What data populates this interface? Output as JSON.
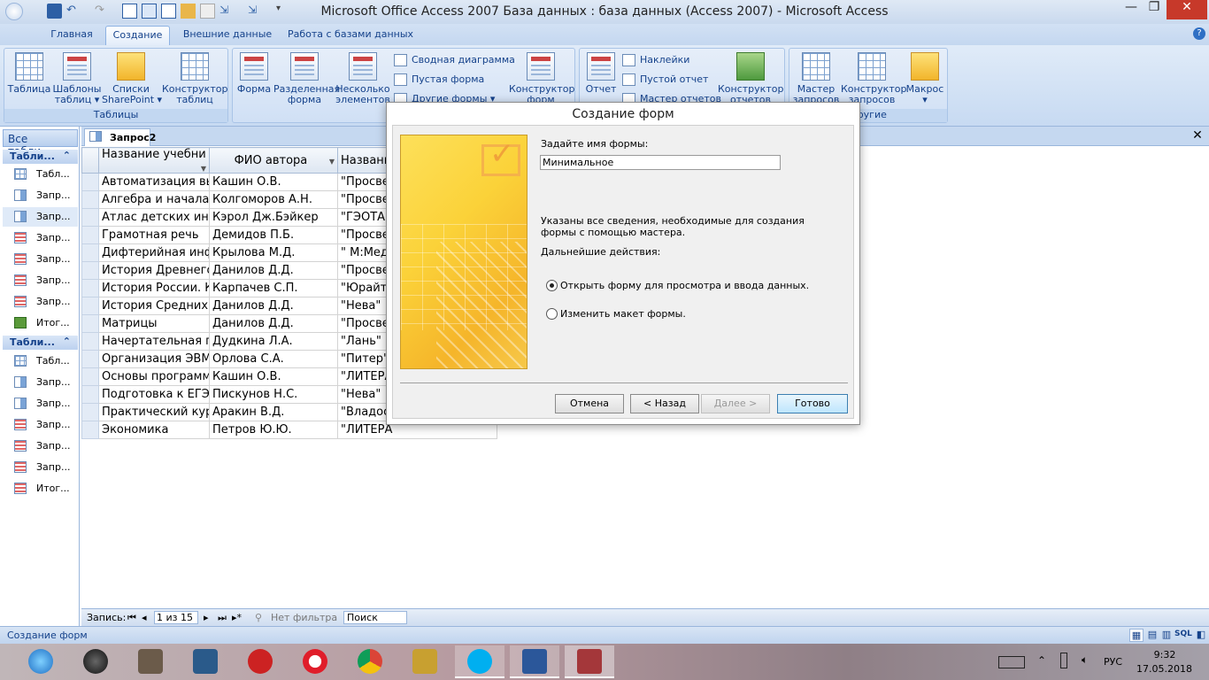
{
  "window": {
    "title": "Microsoft Office Access 2007 База данных : база данных (Access 2007) - Microsoft Access",
    "controls": {
      "minimize": "—",
      "restore": "❐",
      "close": "✕"
    }
  },
  "ribbon_tabs": [
    "Главная",
    "Создание",
    "Внешние данные",
    "Работа с базами данных"
  ],
  "ribbon": {
    "tables": {
      "label": "Таблицы",
      "table": "Таблица",
      "templates": "Шаблоны\nтаблиц ▾",
      "sharepoint": "Списки\nSharePoint ▾",
      "designer": "Конструктор\nтаблиц"
    },
    "forms": {
      "form": "Форма",
      "split": "Разделенная\nформа",
      "multiple": "Несколько\nэлементов",
      "pivot": "Сводная диаграмма",
      "blank": "Пустая форма",
      "other": "Другие формы ▾",
      "designer": "Конструктор\nформ"
    },
    "reports": {
      "report": "Отчет",
      "labels": "Наклейки",
      "blank": "Пустой отчет",
      "wizard": "Мастер отчетов",
      "designer": "Конструктор\nотчетов"
    },
    "other": {
      "label": "Другие",
      "query_wizard": "Мастер\nзапросов",
      "query_designer": "Конструктор\nзапросов",
      "macro": "Макрос\n▾"
    }
  },
  "nav": {
    "header": "Все табли...",
    "sections": [
      {
        "label": "Табли...",
        "chev": "⌃"
      },
      {
        "label": "Табли...",
        "chev": "⌃"
      }
    ],
    "items1": [
      "Табл...",
      "Запр...",
      "Запр...",
      "Запр...",
      "Запр...",
      "Запр...",
      "Запр...",
      "Итог..."
    ],
    "items2": [
      "Табл...",
      "Запр...",
      "Запр...",
      "Запр...",
      "Запр...",
      "Запр...",
      "Итог..."
    ]
  },
  "doc_tab": {
    "label": "Запрос2"
  },
  "grid": {
    "headers": [
      "Название учебни",
      "ФИО автора",
      "Названи"
    ],
    "rows": [
      [
        "Автоматизация выч",
        "Кашин О.В.",
        "\"Просве"
      ],
      [
        "Алгебра и начала м",
        "Колгоморов А.Н.",
        "\"Просве"
      ],
      [
        "Атлас детских инфе",
        "Кэрол Дж.Бэйкер",
        "\"ГЭОТАР"
      ],
      [
        "Грамотная речь",
        "Демидов П.Б.",
        "\"Просве"
      ],
      [
        "Дифтерийная инфе",
        "Крылова М.Д.",
        "\" М:Мед"
      ],
      [
        "История Древнего",
        "Данилов Д.Д.",
        "\"Просве"
      ],
      [
        "История России. Кр",
        "Карпачев С.П.",
        "\"Юрайт\""
      ],
      [
        "История Средних в",
        "Данилов Д.Д.",
        "\"Нева\""
      ],
      [
        "Матрицы",
        "Данилов Д.Д.",
        "\"Просве"
      ],
      [
        "Начертательная ге",
        "Дудкина Л.А.",
        "\"Лань\""
      ],
      [
        "Организация ЭВМ и",
        "Орлова С.А.",
        "\"Питер\""
      ],
      [
        "Основы программ",
        "Кашин О.В.",
        "\"ЛИТЕРА"
      ],
      [
        "Подготовка к ЕГЭ по",
        "Пискунов Н.С.",
        "\"Нева\""
      ],
      [
        "Практический курс",
        "Аракин В.Д.",
        "\"Владос"
      ],
      [
        "Экономика",
        "Петров Ю.Ю.",
        "\"ЛИТЕРА"
      ]
    ]
  },
  "record_nav": {
    "label": "Запись:",
    "first": "⏮",
    "prev": "◂",
    "position": "1 из 15",
    "next": "▸",
    "last": "⏭",
    "new": "▸*",
    "filter": "Нет фильтра",
    "search": "Поиск"
  },
  "status": {
    "text": "Создание форм",
    "views": [
      "▦",
      "▤",
      "▥",
      "SQL",
      "◧"
    ]
  },
  "dialog": {
    "title": "Создание форм",
    "name_prompt": "Задайте имя формы:",
    "name_value": "Минимальное",
    "info": "Указаны все сведения, необходимые для создания формы с помощью мастера.",
    "next_actions": "Дальнейшие действия:",
    "option_open": "Открыть форму для просмотра и ввода данных.",
    "option_modify": "Изменить макет формы.",
    "selected_option": "open",
    "btn_cancel": "Отмена",
    "btn_back": "< Назад",
    "btn_next": "Далее >",
    "btn_finish": "Готово"
  },
  "taskbar": {
    "apps": [
      "ie-icon",
      "speaker-icon",
      "doc-icon",
      "calc-icon",
      "power-icon",
      "opera-icon",
      "chrome-icon",
      "media-icon",
      "skype-icon",
      "word-icon",
      "access-icon"
    ],
    "lang": "РУС",
    "time": "9:32",
    "date": "17.05.2018"
  },
  "colors": {
    "accent": "#15428b",
    "ribbon_bg": "#c7daf2",
    "dialog_art": "#fbd239"
  }
}
